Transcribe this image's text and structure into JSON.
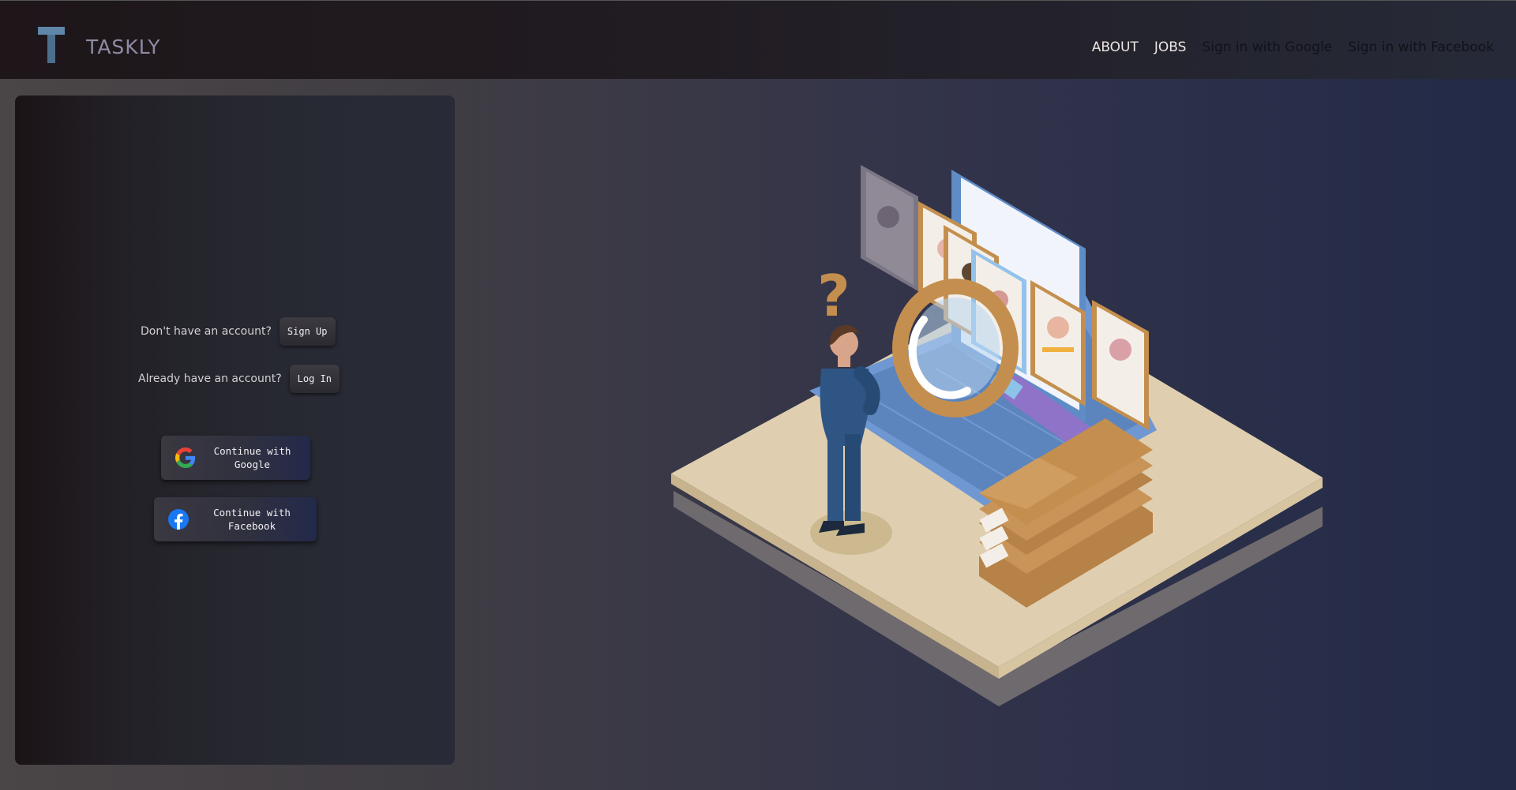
{
  "header": {
    "logo_letter": "T",
    "brand": "TASKLY",
    "nav": [
      {
        "label": "ABOUT"
      },
      {
        "label": "JOBS"
      },
      {
        "label": "Sign in with Google"
      },
      {
        "label": "Sign in with Facebook"
      }
    ]
  },
  "auth": {
    "signup_prompt": "Don't have an account?",
    "signup_button": "Sign Up",
    "login_prompt": "Already have an account?",
    "login_button": "Log In",
    "google_button": "Continue with Google",
    "facebook_button": "Continue with Facebook",
    "google_icon": "google-icon",
    "facebook_icon": "facebook-icon"
  },
  "colors": {
    "brand_text": "#8f8aa4",
    "logo": "#5f86a8",
    "facebook_blue": "#1877f2"
  },
  "illustration": {
    "name": "job-search-illustration"
  }
}
